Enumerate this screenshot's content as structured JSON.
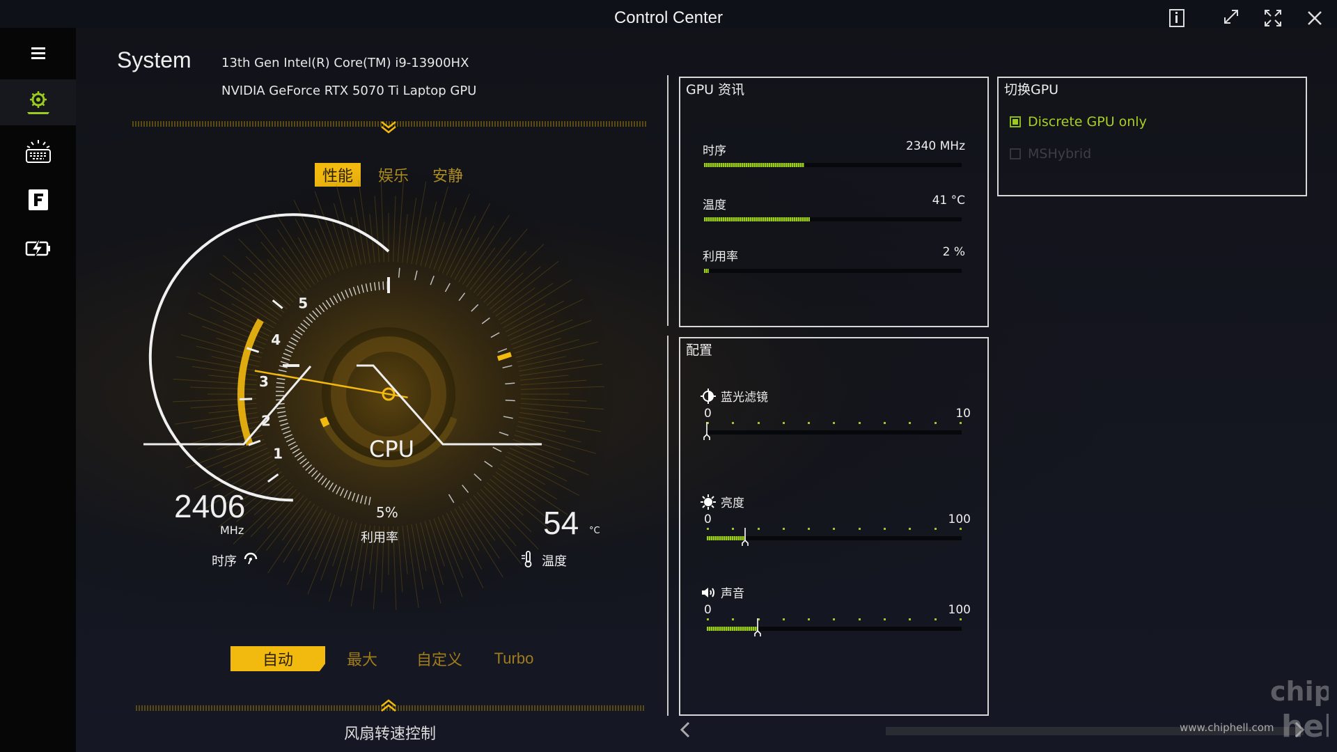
{
  "app": {
    "title": "Control Center"
  },
  "window_controls": [
    "info-icon",
    "restore-icon",
    "fullscreen-icon",
    "close-icon"
  ],
  "sidebar": {
    "items": [
      {
        "name": "menu",
        "icon": "hamburger-icon"
      },
      {
        "name": "system",
        "icon": "gear-laptop-icon",
        "active": true
      },
      {
        "name": "keyboard",
        "icon": "keyboard-backlight-icon"
      },
      {
        "name": "fn",
        "icon": "f-key-icon"
      },
      {
        "name": "battery",
        "icon": "battery-charge-icon"
      }
    ]
  },
  "system": {
    "label": "System",
    "cpu": "13th Gen Intel(R) Core(TM) i9-13900HX",
    "gpu": "NVIDIA GeForce RTX 5070 Ti Laptop GPU"
  },
  "modes": {
    "items": [
      "性能",
      "娱乐",
      "安静"
    ],
    "active_index": 0
  },
  "gauge": {
    "label": "CPU",
    "ticks": [
      "1",
      "2",
      "3",
      "4",
      "5"
    ],
    "needle_value": 3.1,
    "clock_value": "2406",
    "clock_unit": "MHz",
    "clock_label": "时序",
    "usage_value": "5%",
    "usage_label": "利用率",
    "usage_fraction": 0.05,
    "temp_value": "54",
    "temp_unit": "°C",
    "temp_label": "温度"
  },
  "fan": {
    "items": [
      "自动",
      "最大",
      "自定义",
      "Turbo"
    ],
    "active_index": 0,
    "label": "风扇转速控制"
  },
  "gpu_info": {
    "title": "GPU 资讯",
    "stats": [
      {
        "label": "时序",
        "value": "2340 MHz",
        "fraction": 0.39
      },
      {
        "label": "温度",
        "value": "41 °C",
        "fraction": 0.41
      },
      {
        "label": "利用率",
        "value": "2 %",
        "fraction": 0.02
      }
    ]
  },
  "gpu_switch": {
    "title": "切换GPU",
    "options": [
      {
        "label": "Discrete GPU only",
        "checked": true
      },
      {
        "label": "MSHybrid",
        "checked": false
      }
    ]
  },
  "config": {
    "title": "配置",
    "sliders": [
      {
        "label": "蓝光滤镜",
        "icon": "blue-light-icon",
        "min": "0",
        "max": "10",
        "value": 0,
        "range": 10
      },
      {
        "label": "亮度",
        "icon": "brightness-icon",
        "min": "0",
        "max": "100",
        "value": 15,
        "range": 100
      },
      {
        "label": "声音",
        "icon": "volume-icon",
        "min": "0",
        "max": "100",
        "value": 20,
        "range": 100
      }
    ]
  },
  "colors": {
    "accent_yellow": "#f2b90f",
    "accent_green": "#9ccc1e"
  },
  "watermark": "www.chiphell.com"
}
